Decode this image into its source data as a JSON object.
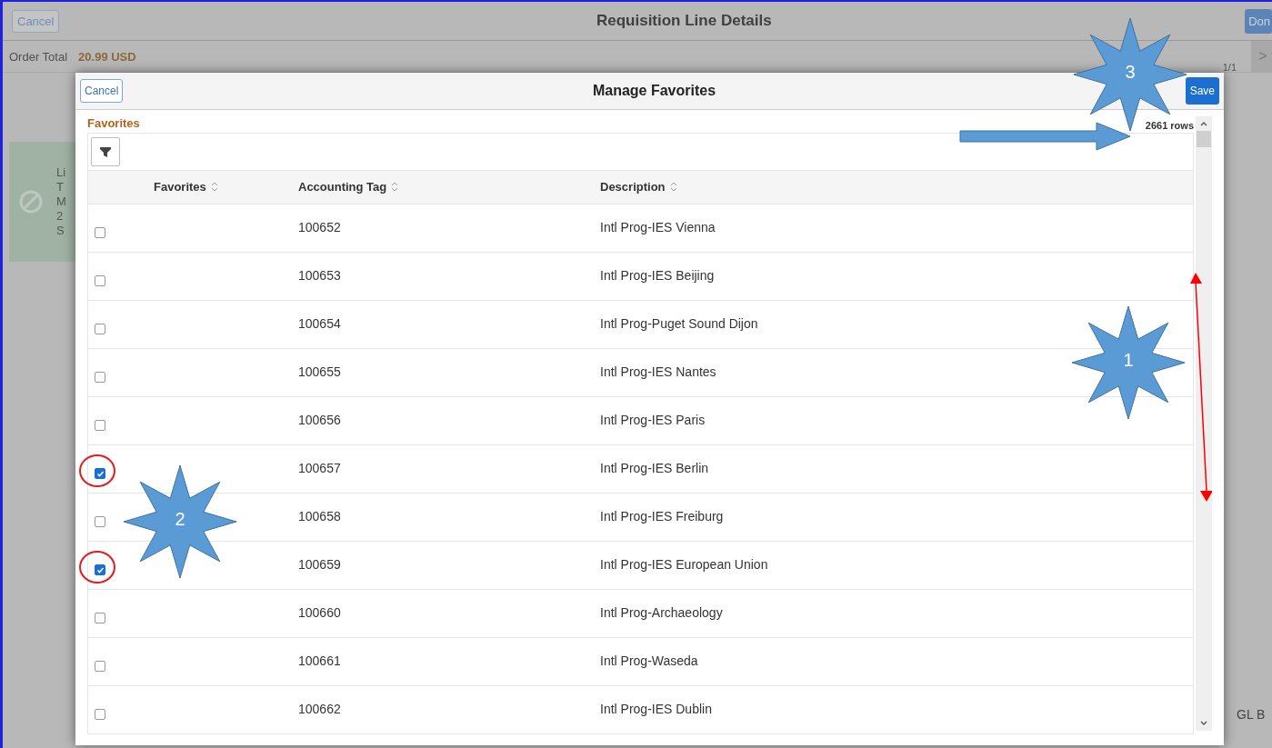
{
  "page": {
    "cancel_button": "Cancel",
    "title": "Requisition Line Details",
    "done_button": "Don",
    "order_total_label": "Order Total",
    "order_total_value": "20.99 USD",
    "pager": "1/1",
    "next_button": ">",
    "card_letters": [
      "Li",
      "T",
      "M",
      "2",
      "S"
    ],
    "side_text": "GL B"
  },
  "modal": {
    "cancel_button": "Cancel",
    "title": "Manage Favorites",
    "save_button": "Save",
    "section_title": "Favorites",
    "row_count": "2661 rows",
    "columns": [
      "Favorites",
      "Accounting Tag",
      "Description"
    ],
    "rows": [
      {
        "tag": "100652",
        "description": "Intl Prog-IES Vienna",
        "checked": false,
        "circled": false
      },
      {
        "tag": "100653",
        "description": "Intl Prog-IES Beijing",
        "checked": false,
        "circled": false
      },
      {
        "tag": "100654",
        "description": "Intl Prog-Puget Sound Dijon",
        "checked": false,
        "circled": false
      },
      {
        "tag": "100655",
        "description": "Intl Prog-IES Nantes",
        "checked": false,
        "circled": false
      },
      {
        "tag": "100656",
        "description": "Intl Prog-IES Paris",
        "checked": false,
        "circled": false
      },
      {
        "tag": "100657",
        "description": "Intl Prog-IES Berlin",
        "checked": true,
        "circled": true
      },
      {
        "tag": "100658",
        "description": "Intl Prog-IES Freiburg",
        "checked": false,
        "circled": false
      },
      {
        "tag": "100659",
        "description": "Intl Prog-IES European Union",
        "checked": true,
        "circled": true
      },
      {
        "tag": "100660",
        "description": "Intl Prog-Archaeology",
        "checked": false,
        "circled": false
      },
      {
        "tag": "100661",
        "description": "Intl Prog-Waseda",
        "checked": false,
        "circled": false
      },
      {
        "tag": "100662",
        "description": "Intl Prog-IES Dublin",
        "checked": false,
        "circled": false
      }
    ]
  },
  "annotations": [
    {
      "kind": "star",
      "label": "3"
    },
    {
      "kind": "arrow"
    },
    {
      "kind": "double_arrow"
    },
    {
      "kind": "star",
      "label": "1"
    },
    {
      "kind": "star",
      "label": "2"
    }
  ]
}
